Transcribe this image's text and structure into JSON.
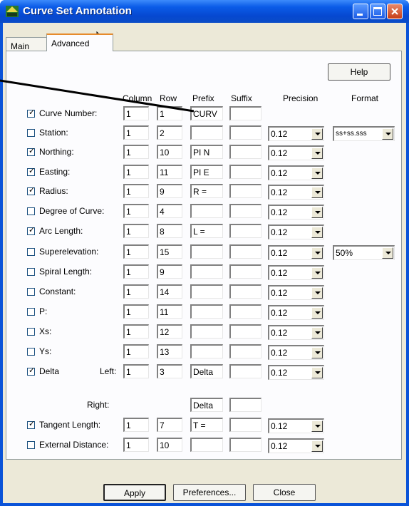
{
  "window": {
    "title": "Curve Set Annotation",
    "icon": "curve-set-app-icon"
  },
  "titlebar_buttons": [
    "minimize-icon",
    "maximize-icon",
    "close-icon"
  ],
  "tabs": [
    {
      "label": "Main"
    },
    {
      "label": "Advanced"
    }
  ],
  "help_label": "Help",
  "columns": {
    "column": "Column",
    "row": "Row",
    "prefix": "Prefix",
    "suffix": "Suffix",
    "precision": "Precision",
    "format": "Format"
  },
  "rows": [
    {
      "label": "Curve Number:",
      "checked": true,
      "column": "1",
      "row": "1",
      "prefix": "CURV",
      "suffix": "",
      "precision": ""
    },
    {
      "label": "Station:",
      "checked": false,
      "column": "1",
      "row": "2",
      "prefix": "",
      "suffix": "",
      "precision": "0.12",
      "format": "ss+ss.sss"
    },
    {
      "label": "Northing:",
      "checked": true,
      "column": "1",
      "row": "10",
      "prefix": "PI N",
      "suffix": "",
      "precision": "0.12"
    },
    {
      "label": "Easting:",
      "checked": true,
      "column": "1",
      "row": "11",
      "prefix": "PI E",
      "suffix": "",
      "precision": "0.12"
    },
    {
      "label": "Radius:",
      "checked": true,
      "column": "1",
      "row": "9",
      "prefix": "R =",
      "suffix": "",
      "precision": "0.12"
    },
    {
      "label": "Degree of Curve:",
      "checked": false,
      "column": "1",
      "row": "4",
      "prefix": "",
      "suffix": "",
      "precision": "0.12"
    },
    {
      "label": "Arc Length:",
      "checked": true,
      "column": "1",
      "row": "8",
      "prefix": "L =",
      "suffix": "",
      "precision": "0.12"
    },
    {
      "label": "Superelevation:",
      "checked": false,
      "column": "1",
      "row": "15",
      "prefix": "",
      "suffix": "",
      "precision": "0.12",
      "format": "50%"
    },
    {
      "label": "Spiral Length:",
      "checked": false,
      "column": "1",
      "row": "9",
      "prefix": "",
      "suffix": "",
      "precision": "0.12"
    },
    {
      "label": "Constant:",
      "checked": false,
      "column": "1",
      "row": "14",
      "prefix": "",
      "suffix": "",
      "precision": "0.12"
    },
    {
      "label": "P:",
      "checked": false,
      "column": "1",
      "row": "11",
      "prefix": "",
      "suffix": "",
      "precision": "0.12"
    },
    {
      "label": "Xs:",
      "checked": false,
      "column": "1",
      "row": "12",
      "prefix": "",
      "suffix": "",
      "precision": "0.12"
    },
    {
      "label": "Ys:",
      "checked": false,
      "column": "1",
      "row": "13",
      "prefix": "",
      "suffix": "",
      "precision": "0.12"
    },
    {
      "label": "Delta",
      "sublabel": "Left:",
      "checked": true,
      "column": "1",
      "row": "3",
      "prefix": "Delta",
      "suffix": "",
      "precision": "0.12"
    },
    {
      "label": "",
      "sublabel": "Right:",
      "prefix": "Delta",
      "suffix": ""
    },
    {
      "label": "Tangent Length:",
      "checked": true,
      "column": "1",
      "row": "7",
      "prefix": "T =",
      "suffix": "",
      "precision": "0.12"
    },
    {
      "label": "External Distance:",
      "checked": false,
      "column": "1",
      "row": "10",
      "prefix": "",
      "suffix": "",
      "precision": "0.12"
    }
  ],
  "buttons": {
    "apply": "Apply",
    "preferences": "Preferences...",
    "close": "Close"
  }
}
